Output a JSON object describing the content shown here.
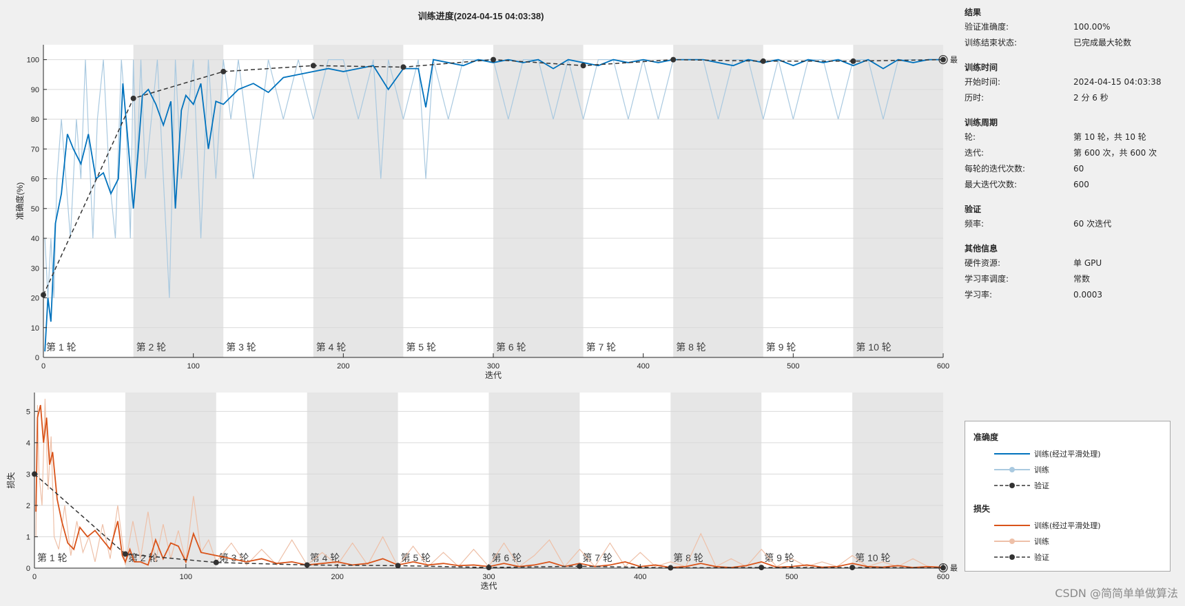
{
  "title": "训练进度(2024-04-15 04:03:38)",
  "info": {
    "sections": [
      {
        "title": "结果",
        "rows": [
          {
            "k": "验证准确度:",
            "v": "100.00%"
          },
          {
            "k": "训练结束状态:",
            "v": "已完成最大轮数"
          }
        ]
      },
      {
        "title": "训练时间",
        "rows": [
          {
            "k": "开始时间:",
            "v": "2024-04-15 04:03:38"
          },
          {
            "k": "历时:",
            "v": "2 分 6 秒"
          }
        ]
      },
      {
        "title": "训练周期",
        "rows": [
          {
            "k": "轮:",
            "v": "第 10 轮，共 10 轮"
          },
          {
            "k": "迭代:",
            "v": "第 600 次，共 600 次"
          },
          {
            "k": "每轮的迭代次数:",
            "v": "60"
          },
          {
            "k": "最大迭代次数:",
            "v": "600"
          }
        ]
      },
      {
        "title": "验证",
        "rows": [
          {
            "k": "频率:",
            "v": "60 次迭代"
          }
        ]
      },
      {
        "title": "其他信息",
        "rows": [
          {
            "k": "硬件资源:",
            "v": "单 GPU"
          },
          {
            "k": "学习率调度:",
            "v": "常数"
          },
          {
            "k": "学习率:",
            "v": "0.0003"
          }
        ]
      }
    ]
  },
  "legend": {
    "accuracy_title": "准确度",
    "loss_title": "损失",
    "smoothed": "训练(经过平滑处理)",
    "train": "训练",
    "validation": "验证"
  },
  "watermark": "CSDN @简简单单做算法",
  "colors": {
    "acc_smoothed": "#0072bd",
    "acc_raw": "#a9c9e0",
    "loss_smoothed": "#d95319",
    "loss_raw": "#eec0a8",
    "validation": "#333333",
    "epoch_band": "#e6e6e6"
  },
  "chart_data": [
    {
      "type": "line",
      "name": "accuracy",
      "xlabel": "迭代",
      "ylabel": "准确度(%)",
      "xlim": [
        0,
        600
      ],
      "ylim": [
        0,
        105
      ],
      "xticks": [
        0,
        100,
        200,
        300,
        400,
        500,
        600
      ],
      "yticks": [
        0,
        10,
        20,
        30,
        40,
        50,
        60,
        70,
        80,
        90,
        100
      ],
      "epoch_labels": [
        "第 1 轮",
        "第 2 轮",
        "第 3 轮",
        "第 4 轮",
        "第 5 轮",
        "第 6 轮",
        "第 7 轮",
        "第 8 轮",
        "第 9 轮",
        "第 10 轮"
      ],
      "final_label": "最终",
      "smoothed": {
        "x": [
          1,
          3,
          5,
          8,
          12,
          16,
          20,
          25,
          30,
          35,
          40,
          45,
          50,
          53,
          56,
          60,
          63,
          66,
          70,
          75,
          80,
          85,
          88,
          92,
          95,
          100,
          105,
          110,
          115,
          120,
          130,
          140,
          150,
          160,
          170,
          180,
          190,
          200,
          210,
          220,
          230,
          240,
          250,
          255,
          260,
          270,
          280,
          290,
          300,
          310,
          320,
          330,
          340,
          350,
          360,
          370,
          380,
          390,
          400,
          410,
          420,
          430,
          440,
          450,
          460,
          470,
          480,
          490,
          500,
          510,
          520,
          530,
          540,
          550,
          560,
          570,
          580,
          590,
          600
        ],
        "y": [
          2,
          20,
          12,
          45,
          55,
          75,
          70,
          65,
          75,
          60,
          62,
          55,
          60,
          92,
          75,
          50,
          68,
          88,
          90,
          85,
          78,
          86,
          50,
          83,
          88,
          85,
          92,
          70,
          86,
          85,
          90,
          92,
          89,
          94,
          95,
          96,
          97,
          96,
          97,
          98,
          90,
          97,
          97,
          84,
          100,
          99,
          98,
          100,
          99,
          100,
          99,
          100,
          97,
          100,
          99,
          98,
          100,
          99,
          100,
          99,
          100,
          100,
          100,
          99,
          98,
          100,
          99,
          100,
          98,
          100,
          99,
          100,
          98,
          100,
          97,
          100,
          99,
          100,
          100
        ]
      },
      "raw": {
        "x": [
          1,
          3,
          5,
          7,
          9,
          12,
          15,
          18,
          22,
          25,
          28,
          33,
          36,
          40,
          44,
          48,
          52,
          55,
          58,
          60,
          62,
          65,
          68,
          72,
          76,
          80,
          84,
          88,
          92,
          96,
          100,
          105,
          110,
          115,
          120,
          125,
          130,
          140,
          150,
          160,
          170,
          180,
          190,
          200,
          210,
          220,
          225,
          230,
          240,
          250,
          255,
          260,
          270,
          280,
          290,
          300,
          310,
          320,
          330,
          340,
          350,
          360,
          370,
          380,
          390,
          400,
          410,
          420,
          430,
          440,
          450,
          460,
          470,
          480,
          490,
          500,
          510,
          520,
          530,
          540,
          550,
          560,
          570,
          580,
          590,
          600
        ],
        "y": [
          40,
          20,
          40,
          20,
          60,
          80,
          60,
          40,
          80,
          60,
          100,
          40,
          80,
          100,
          60,
          40,
          100,
          80,
          40,
          100,
          60,
          100,
          60,
          80,
          100,
          60,
          20,
          100,
          60,
          80,
          100,
          40,
          100,
          60,
          100,
          80,
          100,
          60,
          100,
          80,
          100,
          80,
          100,
          100,
          80,
          100,
          60,
          100,
          80,
          100,
          60,
          100,
          80,
          100,
          100,
          100,
          80,
          100,
          100,
          80,
          100,
          80,
          100,
          100,
          80,
          100,
          80,
          100,
          100,
          100,
          80,
          100,
          100,
          80,
          100,
          80,
          100,
          100,
          80,
          100,
          100,
          80,
          100,
          100,
          100,
          100
        ]
      },
      "validation": {
        "x": [
          0,
          60,
          120,
          180,
          240,
          300,
          360,
          420,
          480,
          540,
          600
        ],
        "y": [
          21,
          87,
          96,
          98,
          97.5,
          100,
          98,
          100,
          99.5,
          99.5,
          100
        ]
      }
    },
    {
      "type": "line",
      "name": "loss",
      "xlabel": "迭代",
      "ylabel": "损失",
      "xlim": [
        0,
        600
      ],
      "ylim": [
        0,
        5.6
      ],
      "xticks": [
        0,
        100,
        200,
        300,
        400,
        500,
        600
      ],
      "yticks": [
        0,
        1,
        2,
        3,
        4,
        5
      ],
      "epoch_labels": [
        "第 1 轮",
        "第 2 轮",
        "第 3 轮",
        "第 4 轮",
        "第 5 轮",
        "第 6 轮",
        "第 7 轮",
        "第 8 轮",
        "第 9 轮",
        "第 10 轮"
      ],
      "final_label": "最终",
      "smoothed": {
        "x": [
          1,
          2,
          4,
          6,
          8,
          10,
          12,
          15,
          18,
          22,
          26,
          30,
          35,
          40,
          45,
          50,
          55,
          58,
          60,
          63,
          66,
          70,
          75,
          80,
          85,
          90,
          95,
          100,
          105,
          110,
          120,
          130,
          140,
          150,
          160,
          170,
          180,
          190,
          200,
          210,
          220,
          230,
          240,
          250,
          260,
          270,
          280,
          290,
          300,
          310,
          320,
          330,
          340,
          350,
          360,
          370,
          380,
          390,
          400,
          410,
          420,
          430,
          440,
          450,
          460,
          470,
          480,
          490,
          500,
          510,
          520,
          530,
          540,
          550,
          560,
          570,
          580,
          590,
          600
        ],
        "y": [
          1.8,
          4.8,
          5.2,
          4.0,
          4.8,
          3.3,
          3.7,
          2.2,
          1.5,
          0.8,
          0.6,
          1.3,
          1.0,
          1.2,
          0.9,
          0.6,
          1.5,
          0.4,
          0.2,
          0.6,
          0.2,
          0.2,
          0.1,
          0.9,
          0.3,
          0.8,
          0.7,
          0.2,
          1.1,
          0.5,
          0.4,
          0.3,
          0.2,
          0.3,
          0.15,
          0.2,
          0.1,
          0.15,
          0.2,
          0.1,
          0.15,
          0.3,
          0.1,
          0.2,
          0.1,
          0.15,
          0.08,
          0.1,
          0.05,
          0.15,
          0.05,
          0.1,
          0.2,
          0.05,
          0.15,
          0.05,
          0.1,
          0.2,
          0.05,
          0.1,
          0.02,
          0.05,
          0.15,
          0.05,
          0.02,
          0.08,
          0.2,
          0.03,
          0.05,
          0.1,
          0.03,
          0.05,
          0.15,
          0.05,
          0.03,
          0.08,
          0.02,
          0.05,
          0.02
        ]
      },
      "raw": {
        "x": [
          1,
          2,
          3,
          5,
          7,
          9,
          11,
          13,
          16,
          20,
          24,
          28,
          32,
          36,
          40,
          45,
          50,
          55,
          60,
          65,
          70,
          75,
          80,
          85,
          90,
          95,
          100,
          105,
          110,
          115,
          120,
          130,
          140,
          150,
          160,
          170,
          180,
          190,
          200,
          210,
          220,
          230,
          240,
          250,
          260,
          270,
          280,
          290,
          300,
          310,
          320,
          330,
          340,
          350,
          360,
          370,
          380,
          390,
          400,
          410,
          420,
          430,
          440,
          450,
          460,
          470,
          480,
          490,
          500,
          510,
          520,
          530,
          540,
          550,
          560,
          570,
          580,
          590,
          600
        ],
        "y": [
          1.0,
          5.2,
          3.0,
          2.0,
          5.4,
          2.5,
          4.2,
          1.0,
          0.6,
          2.0,
          0.4,
          1.5,
          0.5,
          1.0,
          0.2,
          1.4,
          0.3,
          2.0,
          0.1,
          1.5,
          0.3,
          1.8,
          0.2,
          1.4,
          0.3,
          1.2,
          0.2,
          2.3,
          0.5,
          0.9,
          0.2,
          0.8,
          0.1,
          0.6,
          0.1,
          0.9,
          0.1,
          0.5,
          0.1,
          0.8,
          0.1,
          1.0,
          0.05,
          0.7,
          0.05,
          0.5,
          0.05,
          0.6,
          0.05,
          0.8,
          0.05,
          0.4,
          0.9,
          0.05,
          0.6,
          0.05,
          0.8,
          0.05,
          0.5,
          0.05,
          0.2,
          0.05,
          1.1,
          0.05,
          0.3,
          0.05,
          0.6,
          0.05,
          0.3,
          0.05,
          0.2,
          0.05,
          0.4,
          0.05,
          0.2,
          0.05,
          0.3,
          0.05,
          0.05
        ]
      },
      "validation": {
        "x": [
          0,
          60,
          120,
          180,
          240,
          300,
          360,
          420,
          480,
          540,
          600
        ],
        "y": [
          3.0,
          0.45,
          0.18,
          0.1,
          0.08,
          0.02,
          0.06,
          0.01,
          0.02,
          0.02,
          0.01
        ]
      }
    }
  ]
}
